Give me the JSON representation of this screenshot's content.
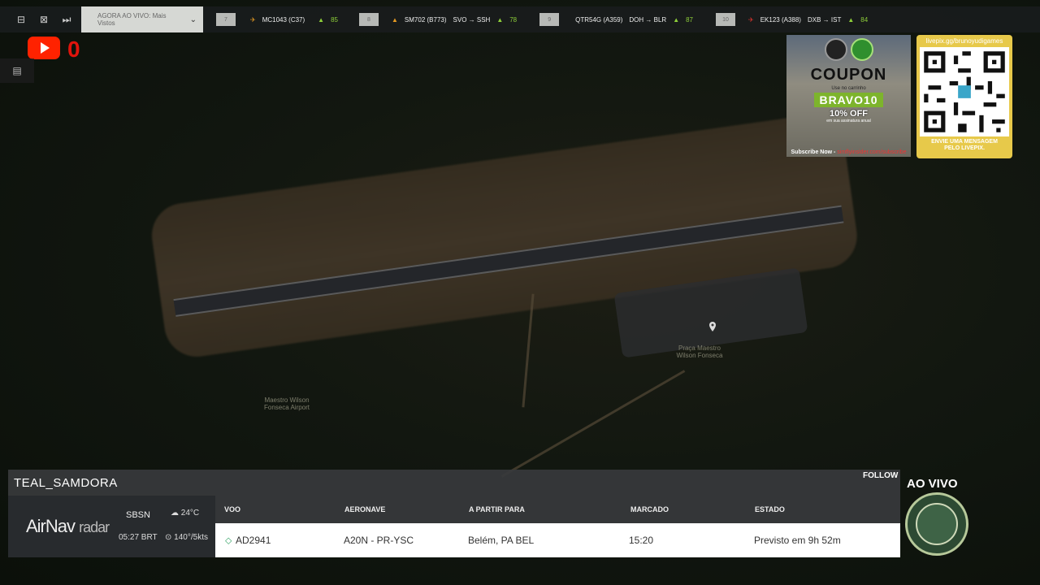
{
  "toolbar": {
    "now_live_label": "AGORA AO VIVO: Mais Vistos",
    "flights": [
      {
        "num": "7",
        "callsign": "MC1043 (C37)",
        "route": "",
        "count": "85"
      },
      {
        "num": "8",
        "callsign": "SM702 (B773)",
        "route": "SVO → SSH",
        "count": "78"
      },
      {
        "num": "9",
        "callsign": "QTR54G (A359)",
        "route": "DOH → BLR",
        "count": "87"
      },
      {
        "num": "10",
        "callsign": "EK123 (A388)",
        "route": "DXB → IST",
        "count": "84"
      }
    ]
  },
  "stream": {
    "youtube_count": "0"
  },
  "map": {
    "airport_label": "Maestro Wilson\nFonseca Airport",
    "plaza_label": "Praça Maestro\nWilson Fonseca"
  },
  "coupon": {
    "title": "COUPON",
    "subtitle": "Use no carrinho",
    "code": "BRAVO10",
    "discount": "10% OFF",
    "note": "em sua assinatura anual",
    "footer_prefix": "Subscribe Now - ",
    "footer_link": "simflyinsider.com/subscribe"
  },
  "livepix": {
    "url": "livepix.gg/brunoyudigames",
    "message": "ENVIE UMA MENSAGEM\nPELO LIVEPIX."
  },
  "panel": {
    "callsign": "TEAL_SAMDORA",
    "follow": "FOLLOW",
    "brand_main": "AirNav",
    "brand_sub": "radar",
    "airport_code": "SBSN",
    "local_time": "05:27 BRT",
    "temperature": "24°C",
    "wind": "140°/5kts",
    "headers": {
      "flight": "VOO",
      "aircraft": "AERONAVE",
      "route": "A PARTIR PARA",
      "scheduled": "MARCADO",
      "status": "ESTADO"
    },
    "row": {
      "flight": "AD2941",
      "aircraft": "A20N - PR-YSC",
      "route": "Belém, PA BEL",
      "scheduled": "15:20",
      "status": "Previsto em 9h 52m"
    }
  },
  "overlay": {
    "live_label": "AO VIVO"
  }
}
